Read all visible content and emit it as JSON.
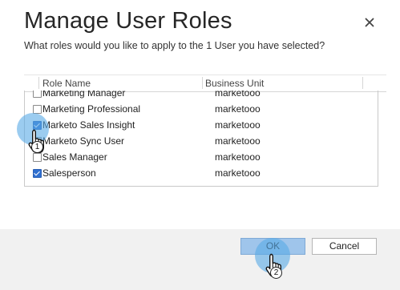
{
  "dialog": {
    "title": "Manage User Roles",
    "subtitle": "What roles would you like to apply to the 1 User you have selected?"
  },
  "grid": {
    "columns": [
      "Role Name",
      "Business Unit"
    ],
    "rows": [
      {
        "name": "Marketing Manager",
        "unit": "marketooo",
        "checked": false
      },
      {
        "name": "Marketing Professional",
        "unit": "marketooo",
        "checked": false
      },
      {
        "name": "Marketo Sales Insight",
        "unit": "marketooo",
        "checked": true
      },
      {
        "name": "Marketo Sync User",
        "unit": "marketooo",
        "checked": false
      },
      {
        "name": "Sales Manager",
        "unit": "marketooo",
        "checked": false
      },
      {
        "name": "Salesperson",
        "unit": "marketooo",
        "checked": true
      }
    ]
  },
  "buttons": {
    "ok": "OK",
    "cancel": "Cancel"
  },
  "annotations": {
    "step1": "1",
    "step2": "2"
  },
  "icons": {
    "close": "close-icon",
    "pointer": "hand-pointer-icon"
  },
  "colors": {
    "accent": "#2f6fd0",
    "primary_button": "#9fc5eb",
    "highlight": "#58aae6",
    "footer": "#f1f1f1"
  }
}
